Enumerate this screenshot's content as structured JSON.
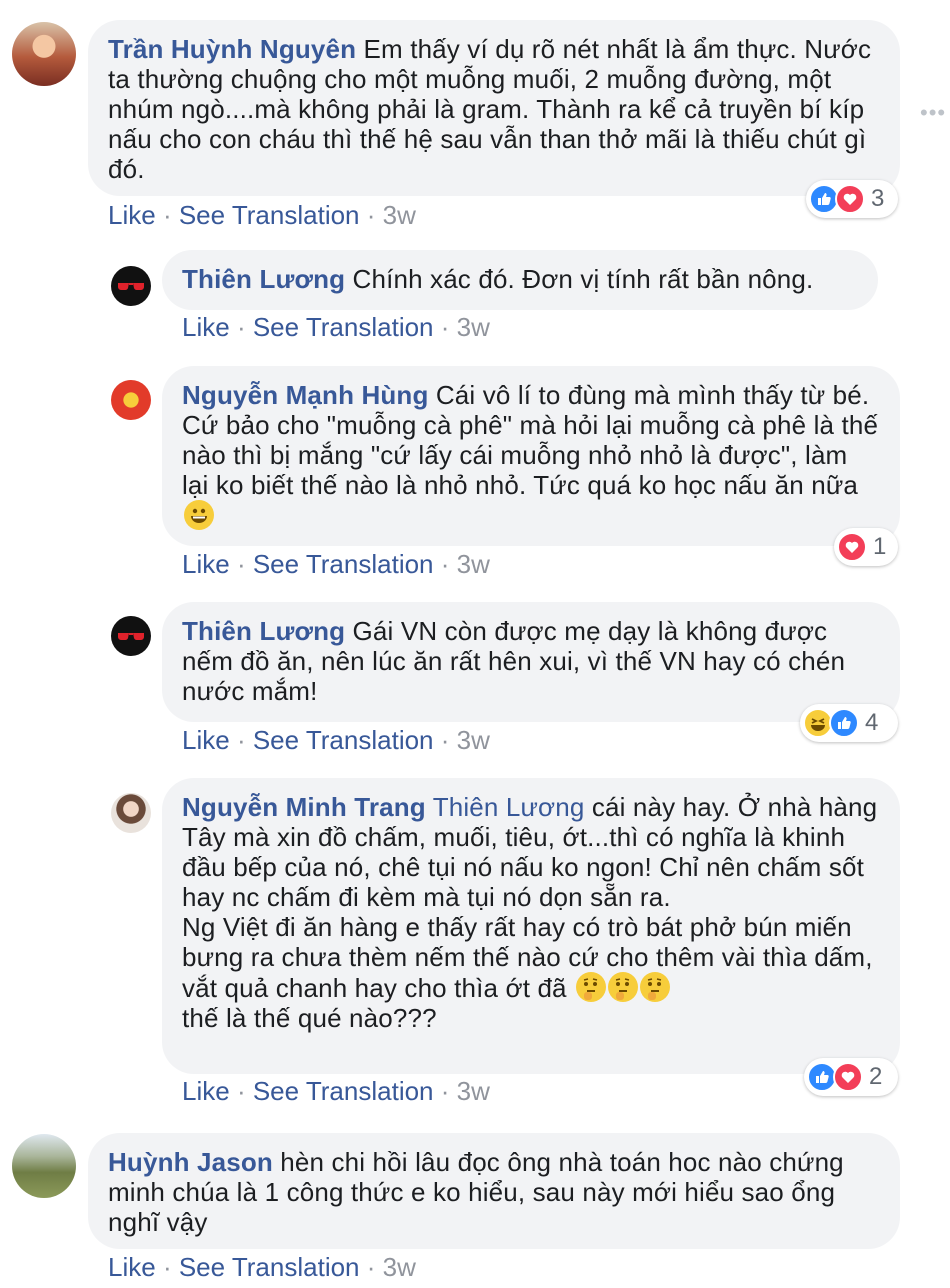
{
  "actions": {
    "like": "Like",
    "see_translation": "See Translation",
    "dot": "·"
  },
  "comments": [
    {
      "author": "Trần Huỳnh Nguyên",
      "text": "Em thấy ví dụ rõ nét nhất là ẩm thực. Nước ta thường chuộng cho một muỗng muối, 2 muỗng đường, một nhúm ngò....mà không phải là gram. Thành ra kể cả truyền bí kíp nấu cho con cháu thì thế hệ sau vẫn than thở mãi là thiếu chút gì đó.",
      "time": "3w",
      "reactions": {
        "icons": [
          "like-icon",
          "love-icon"
        ],
        "count": "3"
      }
    },
    {
      "author": "Thiên Lương",
      "text": "Chính xác đó. Đơn vị tính rất bần nông.",
      "time": "3w"
    },
    {
      "author": "Nguyễn Mạnh Hùng",
      "text": "Cái vô lí to đùng mà mình thấy từ bé. Cứ bảo cho \"muỗng cà phê\" mà hỏi lại muỗng cà phê là thế nào thì bị mắng \"cứ lấy cái muỗng nhỏ nhỏ là được\", làm lại ko biết thế nào là nhỏ nhỏ. Tức quá ko học nấu ăn nữa",
      "emoji": "grinning-face-icon",
      "time": "3w",
      "reactions": {
        "icons": [
          "love-icon"
        ],
        "count": "1"
      }
    },
    {
      "author": "Thiên Lương",
      "text": "Gái VN còn được mẹ dạy là không được nếm đồ ăn, nên lúc ăn rất hên xui, vì thế VN hay có chén nước mắm!",
      "time": "3w",
      "reactions": {
        "icons": [
          "haha-icon",
          "like-icon"
        ],
        "count": "4"
      }
    },
    {
      "author": "Nguyễn Minh Trang",
      "tag": "Thiên Lương",
      "text": "cái này hay. Ở nhà hàng Tây mà xin đồ chấm, muối, tiêu, ớt...thì có nghĩa là khinh đầu bếp của nó, chê tụi nó nấu ko ngon! Chỉ nên chấm sốt hay nc chấm đi kèm mà tụi nó dọn sẵn ra.",
      "text2": "Ng Việt đi ăn hàng e thấy rất hay có trò bát phở bún miến bưng ra chưa thèm nếm thế nào cứ cho thêm vài thìa dấm, vắt quả chanh hay cho thìa ớt đã",
      "text3": "thế là thế qué nào???",
      "emoji": "thinking-face-icon",
      "time": "3w",
      "reactions": {
        "icons": [
          "like-icon",
          "love-icon"
        ],
        "count": "2"
      }
    },
    {
      "author": "Huỳnh Jason",
      "text": "hèn chi hồi lâu đọc ông nhà toán hoc nào chứng minh chúa là 1 công thức e ko hiểu, sau này mới hiểu sao ổng nghĩ vậy",
      "time": "3w"
    }
  ]
}
